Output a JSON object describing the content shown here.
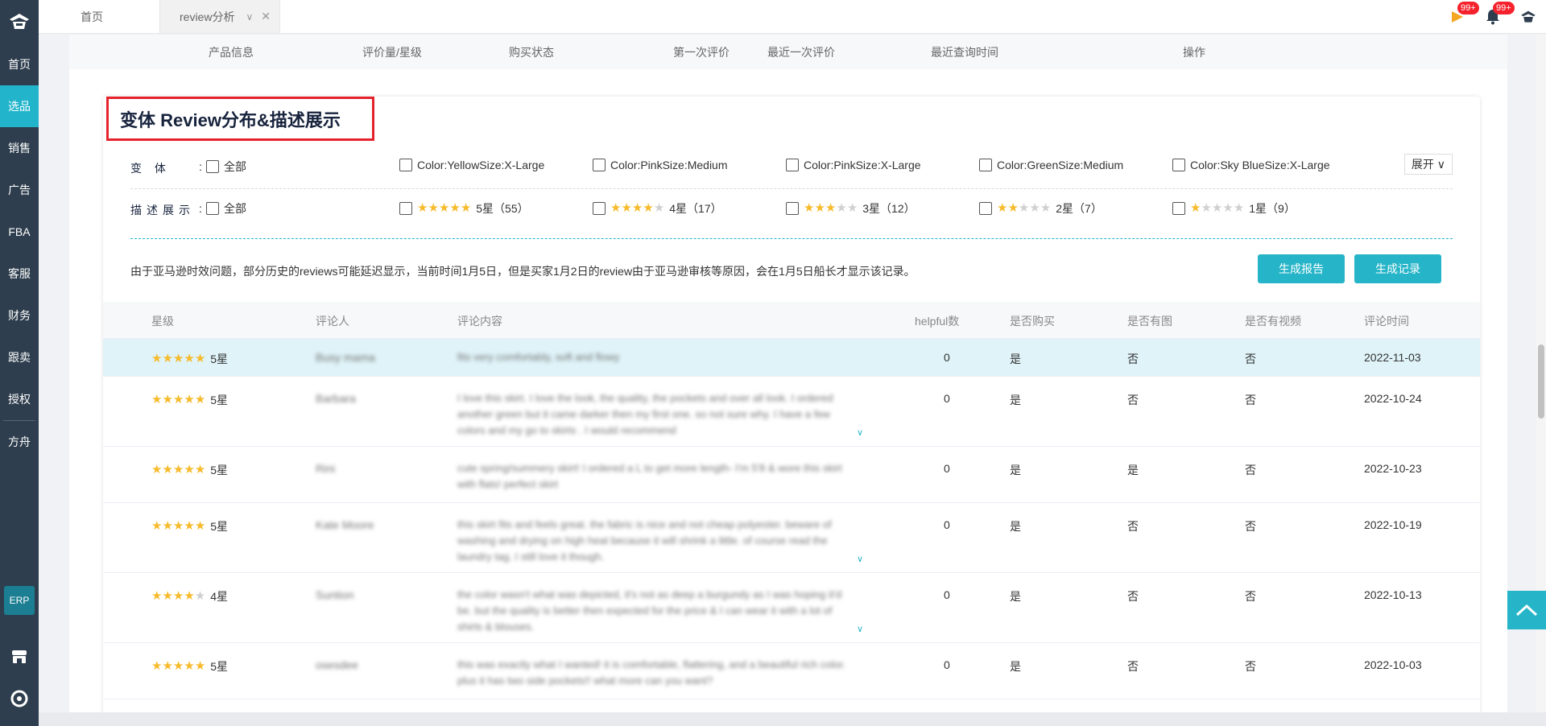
{
  "sidebar": {
    "logo": "app-logo",
    "items": [
      {
        "label": "首页"
      },
      {
        "label": "选品"
      },
      {
        "label": "销售"
      },
      {
        "label": "广告"
      },
      {
        "label": "FBA"
      },
      {
        "label": "客服"
      },
      {
        "label": "财务"
      },
      {
        "label": "跟卖"
      },
      {
        "label": "授权"
      },
      {
        "label": "方舟"
      }
    ],
    "erp_label": "ERP"
  },
  "topbar": {
    "tabs": [
      {
        "label": "首页"
      },
      {
        "label": "review分析"
      }
    ],
    "close_glyph": "✕",
    "chevron_glyph": "∨",
    "flag_badge": "99+",
    "bell_badge": "99+"
  },
  "outer_table_header": [
    "产品信息",
    "评价量/星级",
    "购买状态",
    "第一次评价",
    "最近一次评价",
    "最近查询时间",
    "操作"
  ],
  "section": {
    "title": "变体 Review分布&描述展示",
    "variant_label": "变 体",
    "desc_label": "描述展示",
    "colon": ":",
    "all_label": "全部",
    "expand_label": "展开 ∨",
    "variants": [
      "Color:YellowSize:X-Large",
      "Color:PinkSize:Medium",
      "Color:PinkSize:X-Large",
      "Color:GreenSize:Medium",
      "Color:Sky BlueSize:X-Large"
    ],
    "rating_filters": [
      {
        "stars": 5,
        "label": "5星（55）"
      },
      {
        "stars": 4,
        "label": "4星（17）"
      },
      {
        "stars": 3,
        "label": "3星（12）"
      },
      {
        "stars": 2,
        "label": "2星（7）"
      },
      {
        "stars": 1,
        "label": "1星（9）"
      }
    ],
    "notice": "由于亚马逊时效问题，部分历史的reviews可能延迟显示，当前时间1月5日，但是买家1月2日的review由于亚马逊审核等原因，会在1月5日船长才显示该记录。",
    "btn_report": "生成报告",
    "btn_record": "生成记录"
  },
  "table": {
    "headers": {
      "rating": "星级",
      "reviewer": "评论人",
      "content": "评论内容",
      "helpful": "helpful数",
      "purchased": "是否购买",
      "has_image": "是否有图",
      "has_video": "是否有视频",
      "time": "评论时间"
    },
    "rows": [
      {
        "stars": 5,
        "rating": "5星",
        "reviewer": "Busy mama",
        "content": "fits very comfortably, soft and flowy",
        "helpful": "0",
        "purchased": "是",
        "has_image": "否",
        "has_video": "否",
        "time": "2022-11-03",
        "more": false
      },
      {
        "stars": 5,
        "rating": "5星",
        "reviewer": "Barbara",
        "content": "I love this skirt. I love the look, the quality, the pockets and over all look. I ordered another green but it came darker then my first one. so not sure why. I have a few colors and my go to skirts . I would recommend",
        "helpful": "0",
        "purchased": "是",
        "has_image": "否",
        "has_video": "否",
        "time": "2022-10-24",
        "more": true
      },
      {
        "stars": 5,
        "rating": "5星",
        "reviewer": "Rini",
        "content": "cute spring/summery skirt! I ordered a L to get more length- I'm 5'8 & wore this skirt with flats! perfect skirt",
        "helpful": "0",
        "purchased": "是",
        "has_image": "是",
        "has_video": "否",
        "time": "2022-10-23",
        "more": false
      },
      {
        "stars": 5,
        "rating": "5星",
        "reviewer": "Kate Moore",
        "content": "this skirt fits and feels great. the fabric is nice and not cheap polyester. beware of washing and drying on high heat because it will shrink a little. of course read the laundry tag. I still love it though.",
        "helpful": "0",
        "purchased": "是",
        "has_image": "否",
        "has_video": "否",
        "time": "2022-10-19",
        "more": true
      },
      {
        "stars": 4,
        "rating": "4星",
        "reviewer": "Suntion",
        "content": "the color wasn't what was depicted, it's not as deep a burgundy as I was hoping it'd be. but the quality is better then expected for the price & I can wear it with a lot of shirts & blouses.",
        "helpful": "0",
        "purchased": "是",
        "has_image": "否",
        "has_video": "否",
        "time": "2022-10-13",
        "more": true
      },
      {
        "stars": 5,
        "rating": "5星",
        "reviewer": "osesdee",
        "content": "this was exactly what I wanted! it is comfortable, flattering, and a beautiful rich color. plus it has two side pockets!! what more can you want?",
        "helpful": "0",
        "purchased": "是",
        "has_image": "否",
        "has_video": "否",
        "time": "2022-10-03",
        "more": false
      }
    ]
  },
  "colors": {
    "sidebar_bg": "#2e3e4e",
    "accent": "#26b5c8",
    "star": "#f7ba2a",
    "highlight_border": "#e5212b",
    "row_highlight": "#dff3f8"
  }
}
